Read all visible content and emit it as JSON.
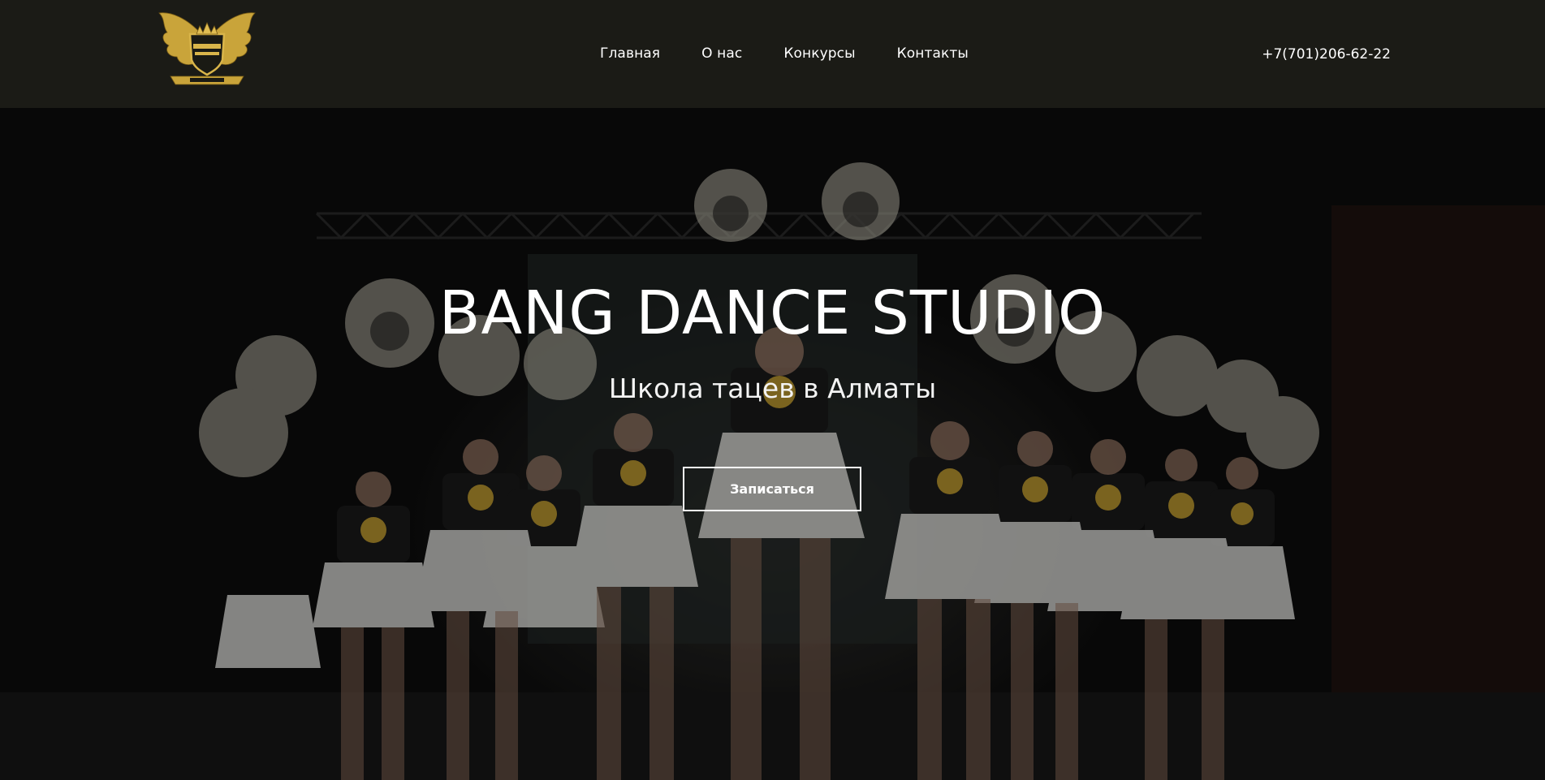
{
  "header": {
    "nav": [
      {
        "label": "Главная"
      },
      {
        "label": "О нас"
      },
      {
        "label": "Конкурсы"
      },
      {
        "label": "Контакты"
      }
    ],
    "phone": "+7(701)206-62-22",
    "logo_icon": "golden-winged-shield-logo"
  },
  "hero": {
    "title": "BANG DANCE STUDIO",
    "subtitle": "Школа тацев в Алматы",
    "cta_label": "Записаться",
    "background_image": "cheerleading-team-on-stage-photo"
  },
  "colors": {
    "header_bg": "#1b1b16",
    "accent_gold": "#c9a43a",
    "text": "#ffffff"
  }
}
